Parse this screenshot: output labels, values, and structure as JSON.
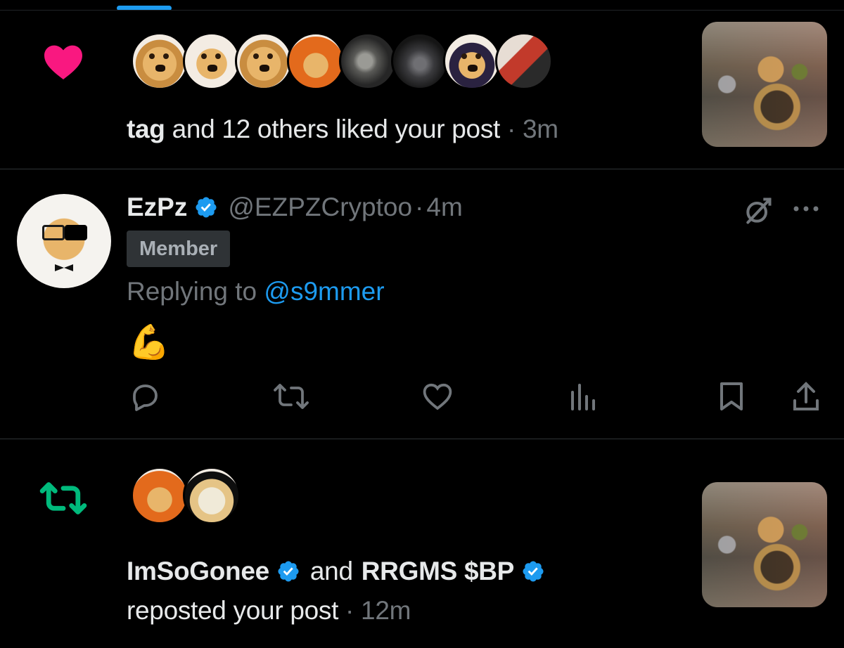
{
  "colors": {
    "background": "#000000",
    "divider": "#2f3336",
    "muted": "#71767b",
    "accent_blue": "#1d9bf0",
    "like_pink": "#f91880",
    "repost_green": "#00ba7c"
  },
  "like_notification": {
    "icon": "heart-icon",
    "liker": "tag",
    "rest": " and 12 others liked your post",
    "separator": " · ",
    "time": "3m"
  },
  "reply": {
    "display_name": "EzPz",
    "handle": "@EZPZCryptoo",
    "separator": "·",
    "time": "4m",
    "badge": "Member",
    "replying_prefix": "Replying to ",
    "replying_to": "@s9mmer",
    "body": "💪",
    "actions": [
      "reply-icon",
      "repost-icon",
      "like-icon",
      "views-icon",
      "bookmark-icon",
      "share-icon"
    ]
  },
  "repost_notification": {
    "icon": "repost-icon",
    "user1": "ImSoGonee",
    "and": "and",
    "user2": "RRGMS $BP",
    "rest": "reposted your post",
    "separator": " · ",
    "time": "12m"
  }
}
